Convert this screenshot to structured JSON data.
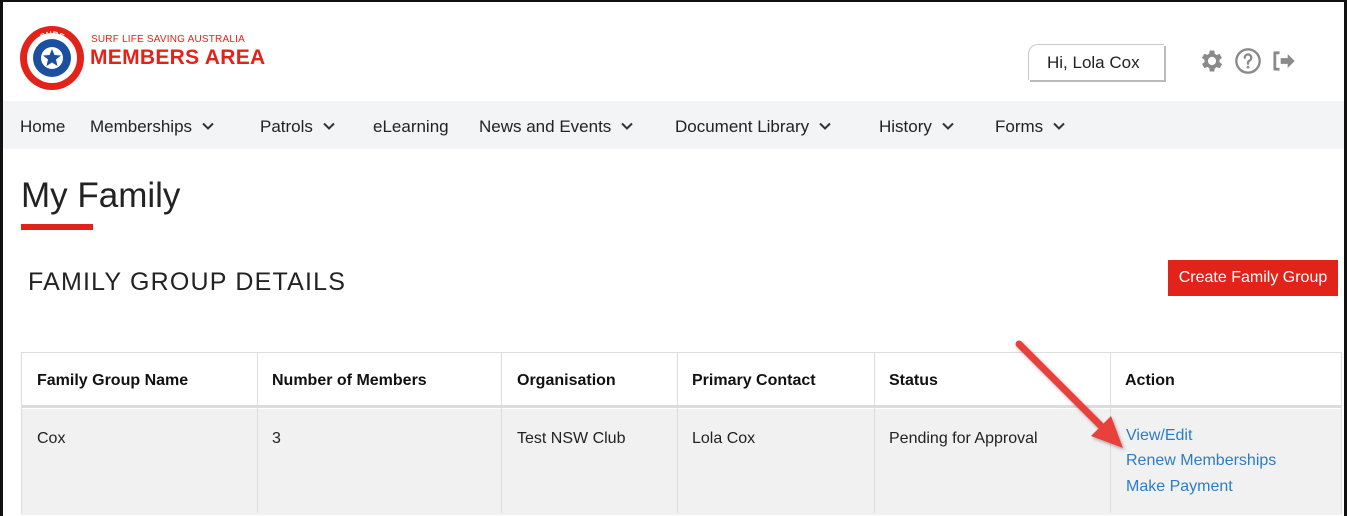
{
  "brand": {
    "small_text": "SURF LIFE SAVING AUSTRALIA",
    "title": "MEMBERS AREA",
    "logo_top": "SURF",
    "logo_bottom": "LIFE SAVING",
    "color": "#e2231a"
  },
  "header": {
    "greeting": "Hi, Lola Cox",
    "icons": [
      "gear-icon",
      "help-icon",
      "logout-icon"
    ]
  },
  "nav": {
    "items": [
      {
        "label": "Home",
        "dropdown": false
      },
      {
        "label": "Memberships",
        "dropdown": true
      },
      {
        "label": "Patrols",
        "dropdown": true
      },
      {
        "label": "eLearning",
        "dropdown": false
      },
      {
        "label": "News and Events",
        "dropdown": true
      },
      {
        "label": "Document Library",
        "dropdown": true
      },
      {
        "label": "History",
        "dropdown": true
      },
      {
        "label": "Forms",
        "dropdown": true
      }
    ]
  },
  "page": {
    "title": "My Family",
    "section_title": "FAMILY GROUP DETAILS",
    "create_button": "Create Family Group"
  },
  "table": {
    "columns": [
      "Family Group Name",
      "Number of Members",
      "Organisation",
      "Primary Contact",
      "Status",
      "Action"
    ],
    "rows": [
      {
        "cells": [
          "Cox",
          "3",
          "Test NSW Club",
          "Lola Cox",
          "Pending for Approval"
        ],
        "actions": [
          "View/Edit",
          "Renew Memberships",
          "Make Payment"
        ]
      }
    ]
  },
  "colors": {
    "accent": "#e2231a",
    "link": "#2a7dc9",
    "nav_bg": "#f2f4f6",
    "row_bg": "#f1f1f1",
    "annotation_arrow": "#e8403a"
  }
}
